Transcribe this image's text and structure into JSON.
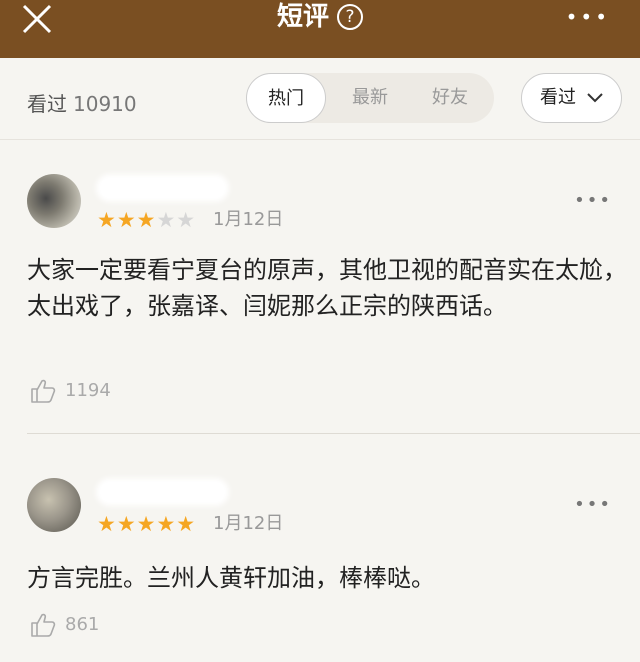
{
  "header": {
    "title": "短评",
    "help_glyph": "?",
    "close_icon": "close-icon",
    "more_glyph": "•••"
  },
  "filter": {
    "seen_label": "看过",
    "seen_count": "10910",
    "tabs": [
      {
        "label": "热门",
        "active": true
      },
      {
        "label": "最新",
        "active": false
      },
      {
        "label": "好友",
        "active": false
      }
    ],
    "sort_label": "看过"
  },
  "comments": [
    {
      "rating": 3,
      "stars_on": "★★★",
      "stars_off": "★★",
      "date": "1月12日",
      "more": "•••",
      "text": "大家一定要看宁夏台的原声，其他卫视的配音实在太尬，太出戏了，张嘉译、闫妮那么正宗的陕西话。",
      "likes": "1194"
    },
    {
      "rating": 5,
      "stars_on": "★★★★★",
      "stars_off": "",
      "date": "1月12日",
      "more": "•••",
      "text": "方言完胜。兰州人黄轩加油，棒棒哒。",
      "likes": "861"
    }
  ]
}
